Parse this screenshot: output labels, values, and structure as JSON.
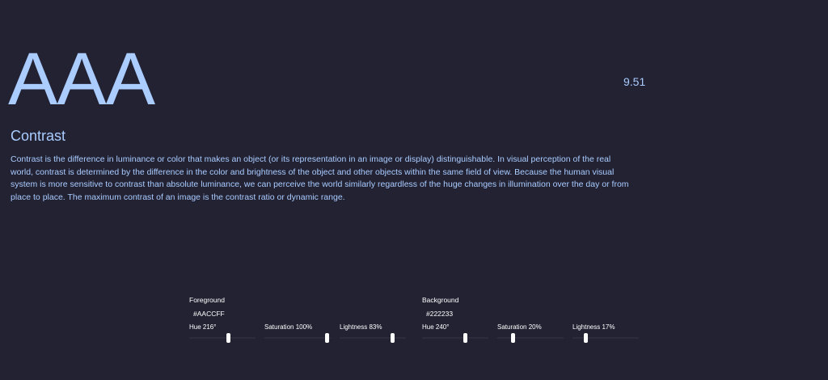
{
  "hero": "AAA",
  "ratio": "9.51",
  "title": "Contrast",
  "description": "Contrast is the difference in luminance or color that makes an object (or its representation in an image or display) distinguishable. In visual perception of the real world, contrast is determined by the difference in the color and brightness of the object and other objects within the same field of view. Because the human visual system is more sensitive to contrast than absolute luminance, we can perceive the world similarly regardless of the huge changes in illumination over the day or from place to place. The maximum contrast of an image is the contrast ratio or dynamic range.",
  "foreground": {
    "label": "Foreground",
    "hex": "#AACCFF",
    "sliders": [
      {
        "label": "Hue 216°",
        "value": 216,
        "max": 360
      },
      {
        "label": "Saturation 100%",
        "value": 100,
        "max": 100
      },
      {
        "label": "Lightness 83%",
        "value": 83,
        "max": 100
      }
    ]
  },
  "background": {
    "label": "Background",
    "hex": "#222233",
    "sliders": [
      {
        "label": "Hue 240°",
        "value": 240,
        "max": 360
      },
      {
        "label": "Saturation 20%",
        "value": 20,
        "max": 100
      },
      {
        "label": "Lightness 17%",
        "value": 17,
        "max": 100
      }
    ]
  },
  "colors": {
    "page_background": "#222233",
    "text": "#AACCFF",
    "control_text": "#FFFFFF",
    "track": "#2C2C3C"
  }
}
